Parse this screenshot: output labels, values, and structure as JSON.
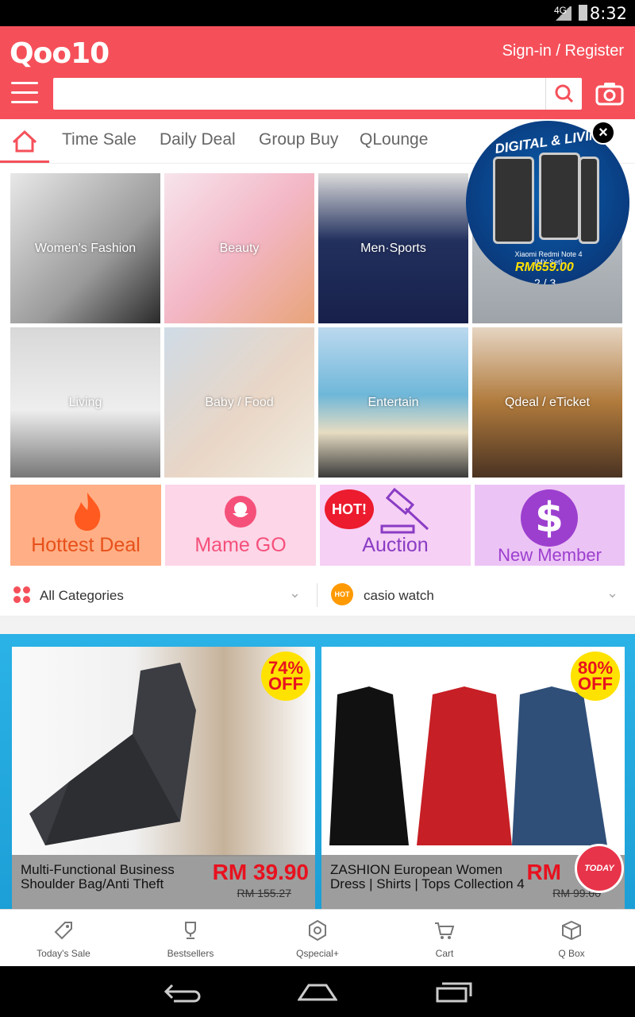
{
  "status_bar": {
    "time": "8:32",
    "network": "4G"
  },
  "header": {
    "logo": "Qoo10",
    "signin": "Sign-in / Register",
    "search_placeholder": ""
  },
  "tabs": [
    "Time Sale",
    "Daily Deal",
    "Group Buy",
    "QLounge"
  ],
  "promo": {
    "title": "DIGITAL & LIVING",
    "model": "Xiaomi Redmi Note 4 [MY Set]",
    "price": "RM659.00",
    "pager": "2 / 3"
  },
  "categories": [
    "Women's Fashion",
    "Beauty",
    "Men·Sports",
    "Living",
    "Baby / Food",
    "Entertain",
    "Qdeal / eTicket"
  ],
  "tiles": [
    {
      "label": "Hottest Deal",
      "color": "#ffae85"
    },
    {
      "label": "Mame GO",
      "color": "#fdd6e8"
    },
    {
      "label": "Auction",
      "color": "#f6d0f5",
      "badge": "HOT!"
    },
    {
      "label": "New Member",
      "color": "#ecc3f5"
    }
  ],
  "filters": {
    "all_categories": "All Categories",
    "hot_badge": "HOT",
    "keyword": "casio watch"
  },
  "products": [
    {
      "name": "Multi-Functional Business Shoulder Bag/Anti Theft",
      "price": "RM 39.90",
      "old_price": "RM 155.27",
      "discount": "74% OFF"
    },
    {
      "name": "ZASHION European Women Dress | Shirts | Tops Collection 4",
      "price": "RM",
      "old_price": "RM 99.00",
      "discount": "80% OFF"
    }
  ],
  "today_button": "TODAY",
  "bottom_nav": [
    "Today's Sale",
    "Bestsellers",
    "Qspecial+",
    "Cart",
    "Q Box"
  ],
  "colors": {
    "brand": "#f5505a",
    "banner": "#2bb2e6"
  }
}
